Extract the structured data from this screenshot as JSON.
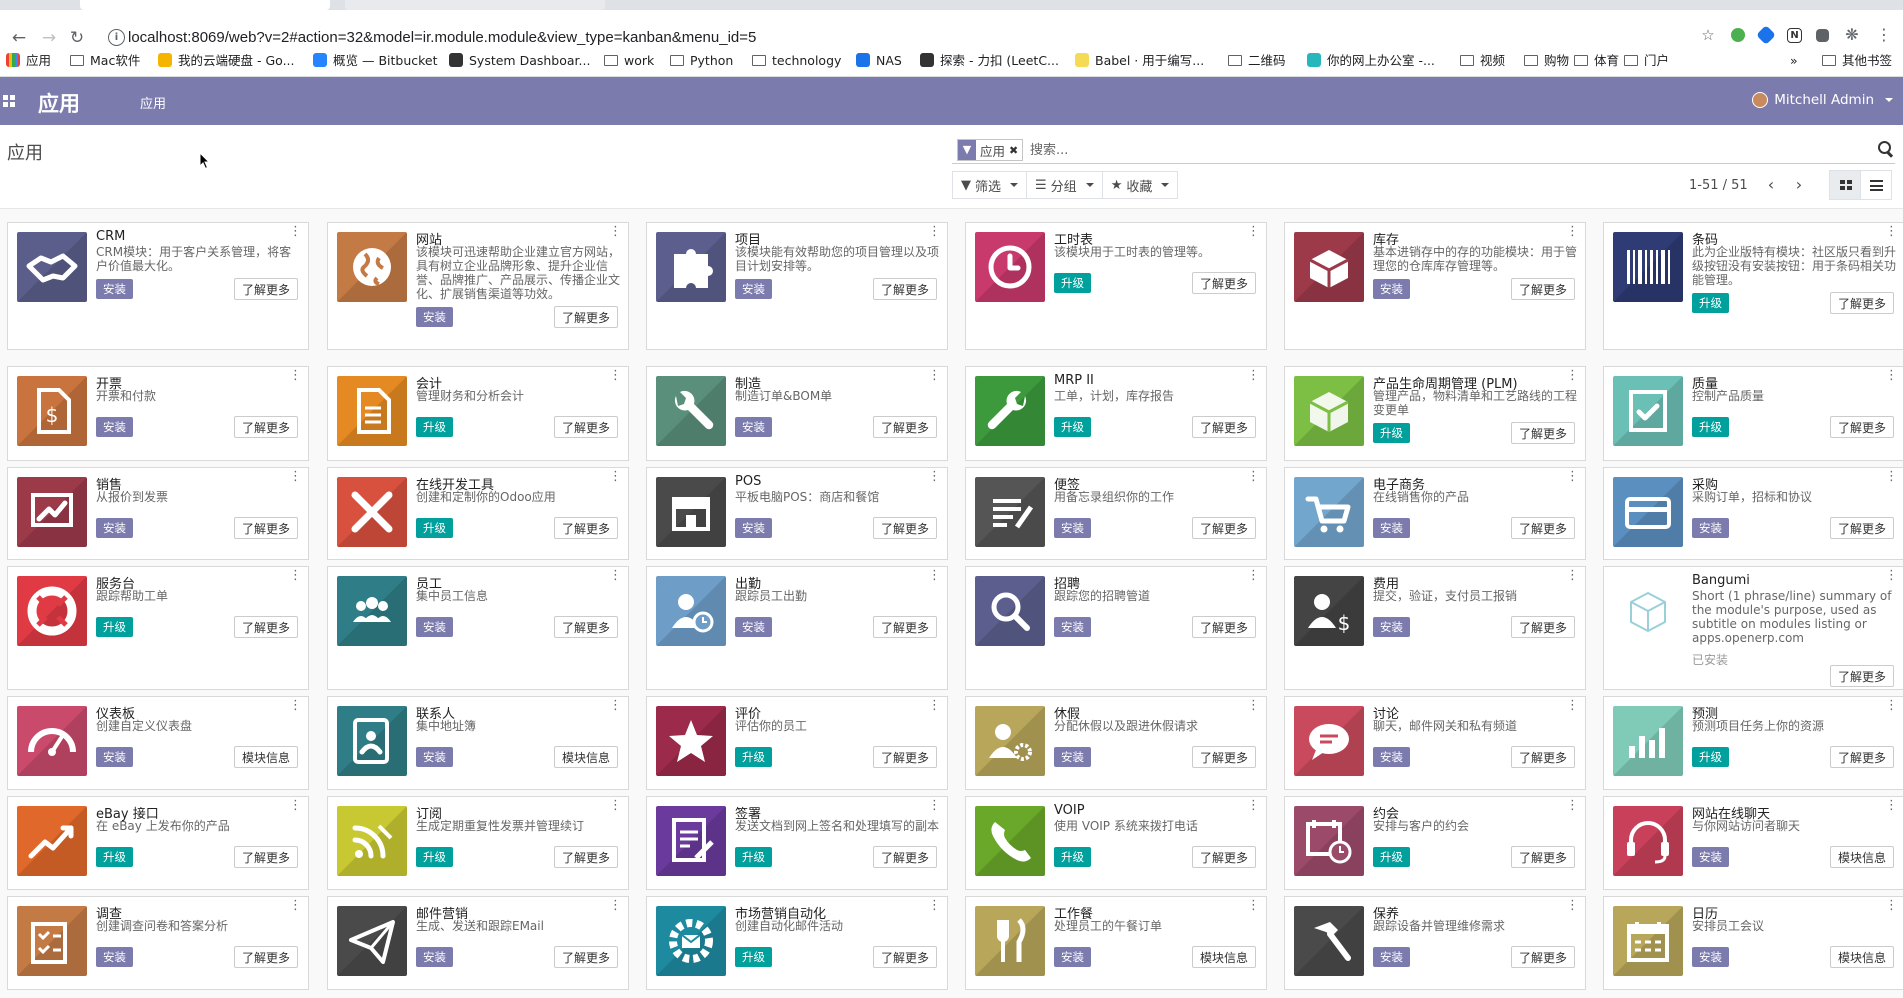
{
  "browser": {
    "url": "localhost:8069/web?v=2#action=32&model=ir.module.module&view_type=kanban&menu_id=5",
    "bookmarks": [
      {
        "label": "应用",
        "type": "grid"
      },
      {
        "label": "Mac软件",
        "type": "folder"
      },
      {
        "label": "我的云端硬盘 - Go...",
        "type": "fav",
        "color": "#f4b400"
      },
      {
        "label": "概览 — Bitbucket",
        "type": "fav",
        "color": "#2684ff"
      },
      {
        "label": "System Dashboar...",
        "type": "fav",
        "color": "#333333"
      },
      {
        "label": "work",
        "type": "folder"
      },
      {
        "label": "Python",
        "type": "folder"
      },
      {
        "label": "technology",
        "type": "folder"
      },
      {
        "label": "NAS",
        "type": "fav",
        "color": "#1a73e8"
      },
      {
        "label": "探索 - 力扣 (LeetC...",
        "type": "fav",
        "color": "#333333"
      },
      {
        "label": "Babel · 用于编写...",
        "type": "fav",
        "color": "#f5da55"
      },
      {
        "label": "二维码",
        "type": "folder"
      },
      {
        "label": "你的网上办公室 -...",
        "type": "fav",
        "color": "#26b7bc"
      },
      {
        "label": "视频",
        "type": "folder"
      },
      {
        "label": "购物",
        "type": "folder"
      },
      {
        "label": "体育",
        "type": "folder"
      },
      {
        "label": "门户",
        "type": "folder"
      }
    ],
    "more_bookmarks": "»",
    "other_bookmarks": "其他书签"
  },
  "navbar": {
    "brand": "应用",
    "menu_item": "应用",
    "user": "Mitchell Admin",
    "color": "#7c7bad"
  },
  "control_panel": {
    "title": "应用",
    "facet_label": "应用",
    "search_placeholder": "搜索...",
    "filter_label": "筛选",
    "groupby_label": "分组",
    "favorites_label": "收藏",
    "pager": "1-51 / 51"
  },
  "colors": {
    "install": "#7c7bad",
    "upgrade": "#00a09d"
  },
  "apps": [
    {
      "title": "CRM",
      "summary": "CRM模块：用于客户关系管理，将客户价值最大化。",
      "action": "安装",
      "more": "了解更多",
      "bg": "#5b5e8a",
      "icon": "handshake"
    },
    {
      "title": "网站",
      "summary": "该模块可迅速帮助企业建立官方网站，具有树立企业品牌形象、提升企业信誉、品牌推广、产品展示、传播企业文化、扩展销售渠道等功效。",
      "action": "安装",
      "more": "了解更多",
      "bg": "#c47a45",
      "icon": "globe"
    },
    {
      "title": "项目",
      "summary": "该模块能有效帮助您的项目管理以及项目计划安排等。",
      "action": "安装",
      "more": "了解更多",
      "bg": "#5c5f8e",
      "icon": "puzzle"
    },
    {
      "title": "工时表",
      "summary": "该模块用于工时表的管理等。",
      "action": "升级",
      "more": "了解更多",
      "bg": "#c83a6b",
      "icon": "clock"
    },
    {
      "title": "库存",
      "summary": "基本进销存中的存的功能模块：用于管理您的仓库库存管理等。",
      "action": "安装",
      "more": "了解更多",
      "bg": "#9c3a4a",
      "icon": "box"
    },
    {
      "title": "条码",
      "summary": "此为企业版特有模块：社区版只看到升级按钮没有安装按钮：用于条码相关功能管理。",
      "action": "升级",
      "more": "了解更多",
      "bg": "#2e3b74",
      "icon": "barcode"
    },
    {
      "title": "开票",
      "summary": "开票和付款",
      "action": "安装",
      "more": "了解更多",
      "bg": "#c9743e",
      "icon": "invoice"
    },
    {
      "title": "会计",
      "summary": "管理财务和分析会计",
      "action": "升级",
      "more": "了解更多",
      "bg": "#e58a22",
      "icon": "doc"
    },
    {
      "title": "制造",
      "summary": "制造订单&BOM单",
      "action": "安装",
      "more": "了解更多",
      "bg": "#5a8f7b",
      "icon": "wrench"
    },
    {
      "title": "MRP II",
      "summary": "工单，计划，库存报告",
      "action": "升级",
      "more": "了解更多",
      "bg": "#3c9a3c",
      "icon": "wrench2"
    },
    {
      "title": "产品生命周期管理 (PLM)",
      "summary": "管理产品，物料清单和工艺路线的工程变更单",
      "action": "升级",
      "more": "了解更多",
      "bg": "#7cbf44",
      "icon": "cube"
    },
    {
      "title": "质量",
      "summary": "控制产品质量",
      "action": "升级",
      "more": "了解更多",
      "bg": "#6bc0b6",
      "icon": "quality"
    },
    {
      "title": "销售",
      "summary": "从报价到发票",
      "action": "安装",
      "more": "了解更多",
      "bg": "#9c3a4a",
      "icon": "chartup"
    },
    {
      "title": "在线开发工具",
      "summary": "创建和定制你的Odoo应用",
      "action": "升级",
      "more": "了解更多",
      "bg": "#d8503e",
      "icon": "tools"
    },
    {
      "title": "POS",
      "summary": "平板电脑POS：商店和餐馆",
      "action": "安装",
      "more": "了解更多",
      "bg": "#4a4a4a",
      "icon": "shop"
    },
    {
      "title": "便签",
      "summary": "用备忘录组织你的工作",
      "action": "安装",
      "more": "了解更多",
      "bg": "#555555",
      "icon": "note"
    },
    {
      "title": "电子商务",
      "summary": "在线销售你的产品",
      "action": "安装",
      "more": "了解更多",
      "bg": "#72a6cc",
      "icon": "cart"
    },
    {
      "title": "采购",
      "summary": "采购订单，招标和协议",
      "action": "安装",
      "more": "了解更多",
      "bg": "#5a8fc0",
      "icon": "card"
    },
    {
      "title": "服务台",
      "summary": "跟踪帮助工单",
      "action": "升级",
      "more": "了解更多",
      "bg": "#e03a45",
      "icon": "lifering"
    },
    {
      "title": "员工",
      "summary": "集中员工信息",
      "action": "安装",
      "more": "了解更多",
      "bg": "#2f7d86",
      "icon": "people"
    },
    {
      "title": "出勤",
      "summary": "跟踪员工出勤",
      "action": "安装",
      "more": "了解更多",
      "bg": "#6e9ec8",
      "icon": "userclock"
    },
    {
      "title": "招聘",
      "summary": "跟踪您的招聘管道",
      "action": "安装",
      "more": "了解更多",
      "bg": "#5c5f8e",
      "icon": "search"
    },
    {
      "title": "费用",
      "summary": "提交，验证，支付员工报销",
      "action": "安装",
      "more": "了解更多",
      "bg": "#444444",
      "icon": "userdollar"
    },
    {
      "title": "Bangumi",
      "summary": "Short (1 phrase/line) summary of the module's purpose, used as subtitle on modules listing or apps.openerp.com",
      "status": "已安装",
      "more": "了解更多",
      "bg": "#ffffff",
      "icon": "outlinecube"
    },
    {
      "title": "仪表板",
      "summary": "创建自定义仪表盘",
      "action": "安装",
      "more": "模块信息",
      "bg": "#c94a6b",
      "icon": "gauge"
    },
    {
      "title": "联系人",
      "summary": "集中地址簿",
      "action": "安装",
      "more": "模块信息",
      "bg": "#2f7d86",
      "icon": "contacts"
    },
    {
      "title": "评价",
      "summary": "评估你的员工",
      "action": "升级",
      "more": "了解更多",
      "bg": "#9c2a4a",
      "icon": "star"
    },
    {
      "title": "休假",
      "summary": "分配休假以及跟进休假请求",
      "action": "安装",
      "more": "了解更多",
      "bg": "#b8a65a",
      "icon": "usergear"
    },
    {
      "title": "讨论",
      "summary": "聊天，邮件网关和私有频道",
      "action": "安装",
      "more": "了解更多",
      "bg": "#c94a5c",
      "icon": "chat"
    },
    {
      "title": "预测",
      "summary": "预测项目任务上你的资源",
      "action": "升级",
      "more": "了解更多",
      "bg": "#7fcbb8",
      "icon": "bars"
    },
    {
      "title": "eBay 接口",
      "summary": "在 eBay 上发布你的产品",
      "action": "升级",
      "more": "了解更多",
      "bg": "#e0682a",
      "icon": "trend"
    },
    {
      "title": "订阅",
      "summary": "生成定期重复性发票并管理续订",
      "action": "升级",
      "more": "了解更多",
      "bg": "#c8c832",
      "icon": "rss"
    },
    {
      "title": "签署",
      "summary": "发送文档到网上签名和处理填写的副本",
      "action": "升级",
      "more": "了解更多",
      "bg": "#6a3a9c",
      "icon": "sign"
    },
    {
      "title": "VOIP",
      "summary": "使用 VOIP 系统来拨打电话",
      "action": "升级",
      "more": "了解更多",
      "bg": "#6aa82a",
      "icon": "phone"
    },
    {
      "title": "约会",
      "summary": "安排与客户的约会",
      "action": "升级",
      "more": "了解更多",
      "bg": "#9c4a6a",
      "icon": "calclock"
    },
    {
      "title": "网站在线聊天",
      "summary": "与你网站访问者聊天",
      "action": "安装",
      "more": "模块信息",
      "bg": "#c9405a",
      "icon": "headset"
    },
    {
      "title": "调查",
      "summary": "创建调查问卷和答案分析",
      "action": "安装",
      "more": "了解更多",
      "bg": "#c47a45",
      "icon": "survey"
    },
    {
      "title": "邮件营销",
      "summary": "生成、发送和跟踪EMail",
      "action": "安装",
      "more": "了解更多",
      "bg": "#4a4a4a",
      "icon": "plane"
    },
    {
      "title": "市场营销自动化",
      "summary": "创建自动化邮件活动",
      "action": "升级",
      "more": "了解更多",
      "bg": "#1e8aa0",
      "icon": "gearmail"
    },
    {
      "title": "工作餐",
      "summary": "处理员工的午餐订单",
      "action": "安装",
      "more": "模块信息",
      "bg": "#b8a65a",
      "icon": "fork"
    },
    {
      "title": "保养",
      "summary": "跟踪设备并管理维修需求",
      "action": "安装",
      "more": "了解更多",
      "bg": "#4a4a4a",
      "icon": "hammer"
    },
    {
      "title": "日历",
      "summary": "安排员工会议",
      "action": "安装",
      "more": "模块信息",
      "bg": "#b8a65a",
      "icon": "calendar"
    }
  ]
}
